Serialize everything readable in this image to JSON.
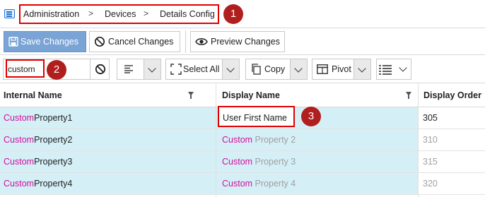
{
  "breadcrumb": {
    "items": [
      "Administration",
      "Devices",
      "Details Config"
    ],
    "separator": ">"
  },
  "callouts": [
    "1",
    "2",
    "3"
  ],
  "toolbar": {
    "save_label": "Save Changes",
    "cancel_label": "Cancel Changes",
    "preview_label": "Preview Changes"
  },
  "filterbar": {
    "search_value": "custom",
    "select_all_label": "Select All",
    "copy_label": "Copy",
    "pivot_label": "Pivot"
  },
  "grid": {
    "columns": [
      "Internal Name",
      "Display Name",
      "Display Order"
    ],
    "rows": [
      {
        "internal_match": "Custom",
        "internal_rest": "Property1",
        "display_match": "",
        "display_rest": "User First Name",
        "order": "305",
        "edited": true
      },
      {
        "internal_match": "Custom",
        "internal_rest": "Property2",
        "display_match": "Custom",
        "display_rest": " Property 2",
        "order": "310",
        "edited": false
      },
      {
        "internal_match": "Custom",
        "internal_rest": "Property3",
        "display_match": "Custom",
        "display_rest": " Property 3",
        "order": "315",
        "edited": false
      },
      {
        "internal_match": "Custom",
        "internal_rest": "Property4",
        "display_match": "Custom",
        "display_rest": " Property 4",
        "order": "320",
        "edited": false
      }
    ]
  },
  "colors": {
    "highlight_text": "#d0119a",
    "row_bg": "#d5eff7",
    "callout_red": "#e00000",
    "badge_fill": "#b01e1e",
    "primary_button": "#7aa3d6"
  }
}
